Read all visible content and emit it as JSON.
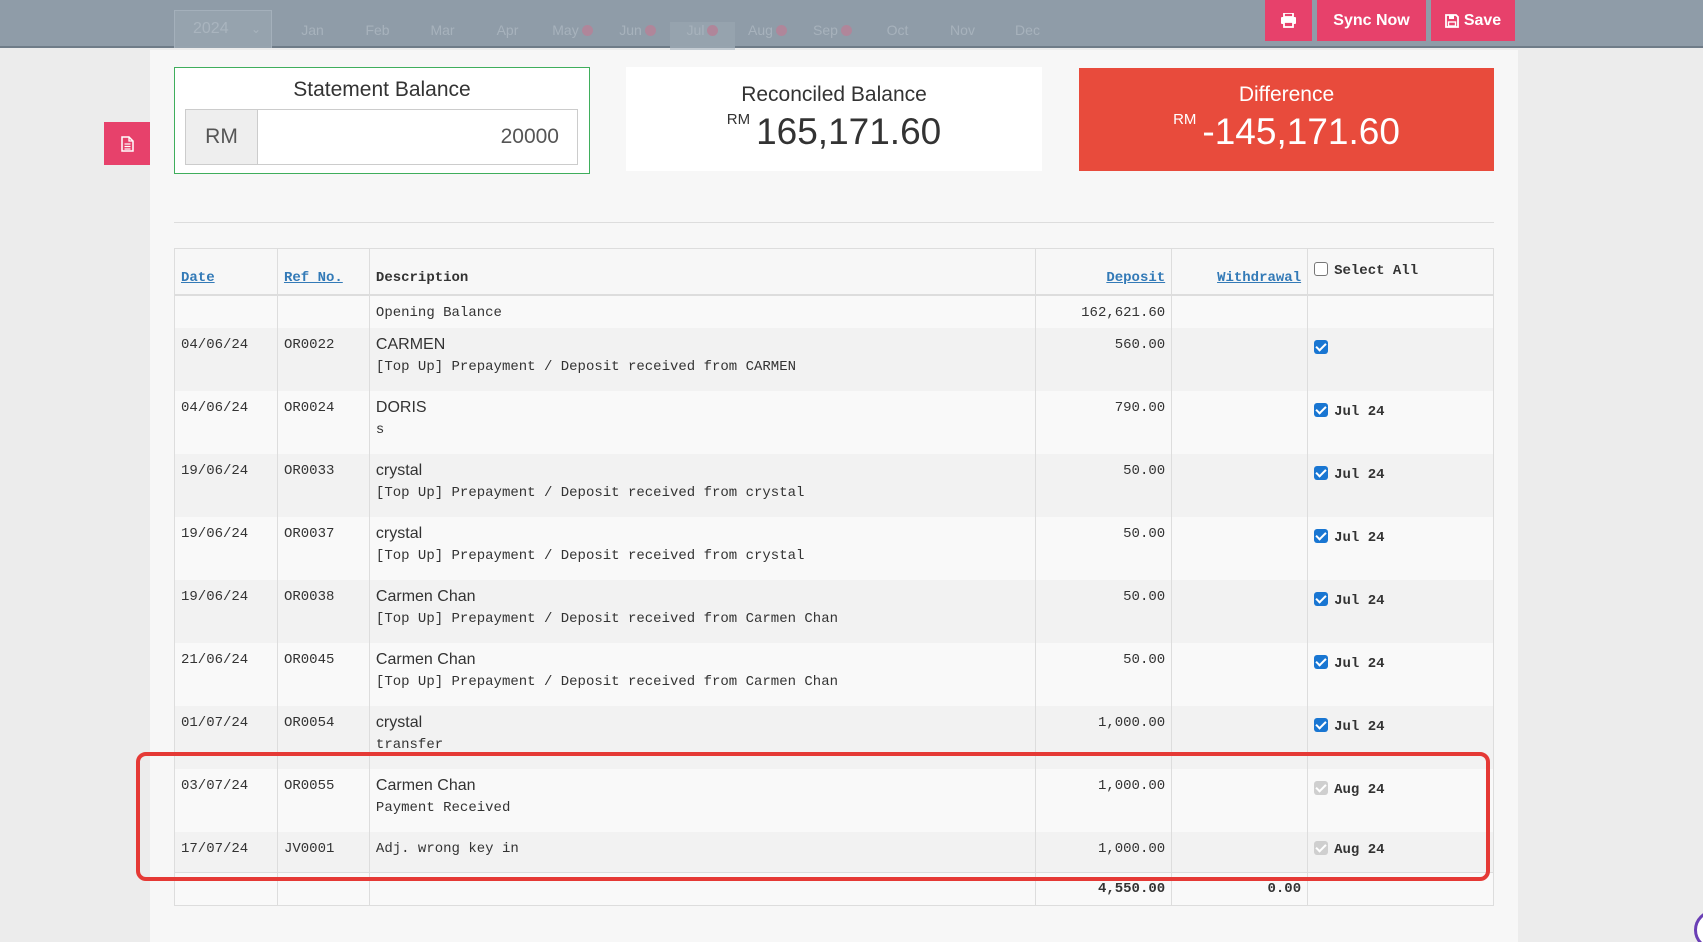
{
  "topbar": {
    "year": "2024",
    "months": [
      {
        "label": "Jan",
        "dot": false
      },
      {
        "label": "Feb",
        "dot": false
      },
      {
        "label": "Mar",
        "dot": false
      },
      {
        "label": "Apr",
        "dot": false
      },
      {
        "label": "May",
        "dot": true
      },
      {
        "label": "Jun",
        "dot": true
      },
      {
        "label": "Jul",
        "dot": true,
        "active": true
      },
      {
        "label": "Aug",
        "dot": true
      },
      {
        "label": "Sep",
        "dot": true
      },
      {
        "label": "Oct",
        "dot": false
      },
      {
        "label": "Nov",
        "dot": false
      },
      {
        "label": "Dec",
        "dot": false
      }
    ],
    "sync_label": "Sync Now",
    "save_label": "Save"
  },
  "statement": {
    "title": "Statement Balance",
    "currency": "RM",
    "value": "20000"
  },
  "reconciled": {
    "title": "Reconciled Balance",
    "currency": "RM",
    "value": "165,171.60"
  },
  "difference": {
    "title": "Difference",
    "currency": "RM",
    "value": "-145,171.60"
  },
  "table": {
    "headers": {
      "date": "Date",
      "ref": "Ref No.",
      "description": "Description",
      "deposit": "Deposit",
      "withdrawal": "Withdrawal",
      "select_all": "Select All"
    },
    "opening": {
      "description": "Opening Balance",
      "deposit": "162,621.60"
    },
    "rows": [
      {
        "date": "04/06/24",
        "ref": "OR0022",
        "name": "CARMEN",
        "note": "[Top Up] Prepayment / Deposit received from CARMEN",
        "deposit": "560.00",
        "month": ""
      },
      {
        "date": "04/06/24",
        "ref": "OR0024",
        "name": "DORIS",
        "note": "s",
        "deposit": "790.00",
        "month": "Jul 24"
      },
      {
        "date": "19/06/24",
        "ref": "OR0033",
        "name": "crystal",
        "note": "[Top Up] Prepayment / Deposit received from crystal",
        "deposit": "50.00",
        "month": "Jul 24"
      },
      {
        "date": "19/06/24",
        "ref": "OR0037",
        "name": "crystal",
        "note": "[Top Up] Prepayment / Deposit received from crystal",
        "deposit": "50.00",
        "month": "Jul 24"
      },
      {
        "date": "19/06/24",
        "ref": "OR0038",
        "name": "Carmen Chan",
        "note": "[Top Up] Prepayment / Deposit received from Carmen Chan",
        "deposit": "50.00",
        "month": "Jul 24"
      },
      {
        "date": "21/06/24",
        "ref": "OR0045",
        "name": "Carmen Chan",
        "note": "[Top Up] Prepayment / Deposit received from Carmen Chan",
        "deposit": "50.00",
        "month": "Jul 24"
      },
      {
        "date": "01/07/24",
        "ref": "OR0054",
        "name": "crystal",
        "note": "transfer",
        "deposit": "1,000.00",
        "month": "Jul 24"
      },
      {
        "date": "03/07/24",
        "ref": "OR0055",
        "name": "Carmen Chan",
        "note": "Payment Received",
        "deposit": "1,000.00",
        "month": "Aug 24"
      }
    ],
    "last_row": {
      "date": "17/07/24",
      "ref": "JV0001",
      "description": "Adj. wrong key in",
      "deposit": "1,000.00",
      "month": "Aug 24"
    },
    "totals": {
      "deposit": "4,550.00",
      "withdrawal": "0.00"
    }
  },
  "icons": {
    "print": "printer-icon",
    "save": "floppy-disk-icon",
    "side": "document-icon"
  },
  "colors": {
    "accent": "#e7416b",
    "difference": "#e84b3c",
    "statement_border": "#3fae5c",
    "link": "#337ab7",
    "highlight": "#e53935"
  }
}
